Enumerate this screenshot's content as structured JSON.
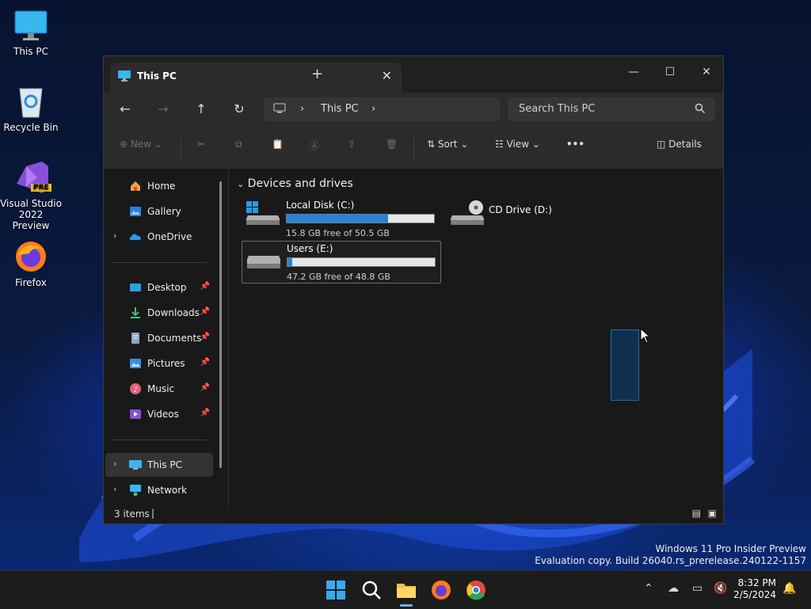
{
  "desktop": {
    "icons": [
      {
        "label": "This PC"
      },
      {
        "label": "Recycle Bin"
      },
      {
        "label": "Visual Studio 2022 Preview",
        "badge": "PRE"
      },
      {
        "label": "Firefox"
      }
    ]
  },
  "window": {
    "tab_title": "This PC",
    "address": {
      "segments": [
        "This PC"
      ]
    },
    "search_placeholder": "Search This PC",
    "toolbar": {
      "new_label": "New",
      "sort_label": "Sort",
      "view_label": "View",
      "more_label": "•••",
      "details_label": "Details"
    },
    "nav": {
      "items": [
        {
          "label": "Home",
          "icon": "home-icon"
        },
        {
          "label": "Gallery",
          "icon": "gallery-icon"
        },
        {
          "label": "OneDrive",
          "icon": "onedrive-icon"
        },
        {
          "label": "Desktop",
          "icon": "desktop-folder-icon"
        },
        {
          "label": "Downloads",
          "icon": "downloads-folder-icon"
        },
        {
          "label": "Documents",
          "icon": "documents-folder-icon"
        },
        {
          "label": "Pictures",
          "icon": "pictures-folder-icon"
        },
        {
          "label": "Music",
          "icon": "music-folder-icon"
        },
        {
          "label": "Videos",
          "icon": "videos-folder-icon"
        },
        {
          "label": "This PC",
          "icon": "this-pc-icon"
        },
        {
          "label": "Network",
          "icon": "network-icon"
        }
      ]
    },
    "group_header": "Devices and drives",
    "drives": [
      {
        "name": "Local Disk (C:)",
        "free": "15.8 GB free of 50.5 GB",
        "used_fraction": 0.687
      },
      {
        "name": "CD Drive (D:)"
      },
      {
        "name": "Users (E:)",
        "free": "47.2 GB free of 48.8 GB",
        "used_fraction": 0.033
      }
    ],
    "status": "3 items"
  },
  "watermark": {
    "line1": "Windows 11 Pro Insider Preview",
    "line2": "Evaluation copy. Build 26040.rs_prerelease.240122-1157"
  },
  "taskbar": {
    "time": "8:32 PM",
    "date": "2/5/2024"
  },
  "colors": {
    "accent": "#2684d8",
    "window_bg": "#191919",
    "toolbar_bg": "#2b2b2b"
  }
}
